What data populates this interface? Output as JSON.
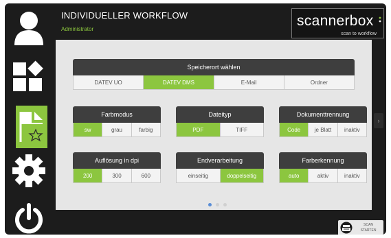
{
  "header": {
    "title": "INDIVIDUELLER WORKFLOW",
    "subtitle": "Administrator"
  },
  "logo": {
    "main": "scannerbox",
    "tagline": "scan to workflow"
  },
  "sidebar": {
    "items": [
      {
        "icon": "user-icon"
      },
      {
        "icon": "modules-icon"
      },
      {
        "icon": "workflow-favorite-icon",
        "active": true
      },
      {
        "icon": "gear-icon"
      },
      {
        "icon": "power-icon"
      }
    ]
  },
  "settings": {
    "speicherort": {
      "label": "Speicherort wählen",
      "options": [
        "DATEV UO",
        "DATEV DMS",
        "E-Mail",
        "Ordner"
      ],
      "selected": "DATEV DMS"
    },
    "farbmodus": {
      "label": "Farbmodus",
      "options": [
        "sw",
        "grau",
        "farbig"
      ],
      "selected": "sw"
    },
    "dateityp": {
      "label": "Dateityp",
      "options": [
        "PDF",
        "TIFF"
      ],
      "selected": "PDF"
    },
    "dokumenttrennung": {
      "label": "Dokumenttrennung",
      "options": [
        "Code",
        "je Blatt",
        "inaktiv"
      ],
      "selected": "Code"
    },
    "aufloesung": {
      "label": "Auflösung in dpi",
      "options": [
        "200",
        "300",
        "600"
      ],
      "selected": "200"
    },
    "endverarbeitung": {
      "label": "Endverarbeitung",
      "options": [
        "einseitig",
        "doppelseitig"
      ],
      "selected": "doppelseitig"
    },
    "farberkennung": {
      "label": "Farberkennung",
      "options": [
        "auto",
        "aktiv",
        "inaktiv"
      ],
      "selected": "auto"
    }
  },
  "pager": {
    "pages": 3,
    "current": 1
  },
  "next_arrow": "›",
  "scan_button": {
    "line1": "SCAN",
    "line2": "STARTEN"
  },
  "colors": {
    "accent": "#8cc63f",
    "background": "#1c1c1c",
    "panel": "#e6e6e6",
    "group_header": "#3e3e3e"
  }
}
